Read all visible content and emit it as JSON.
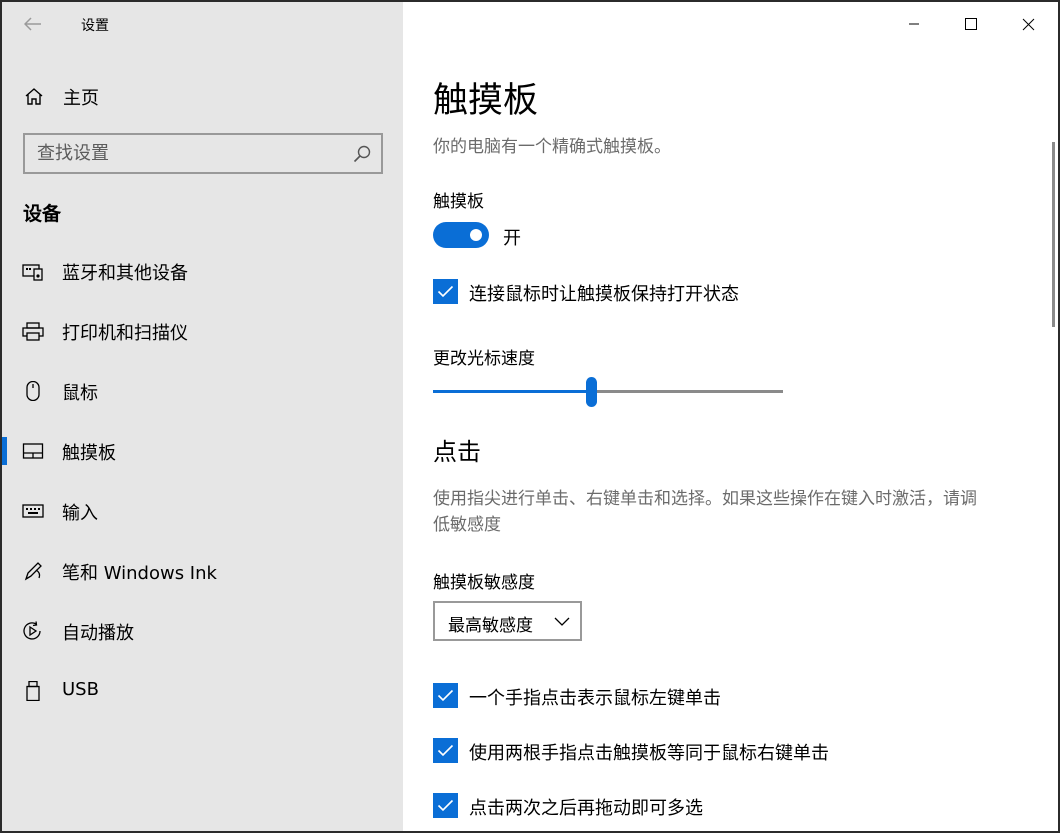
{
  "window": {
    "title": "设置"
  },
  "sidebar": {
    "home_label": "主页",
    "search_placeholder": "查找设置",
    "section_title": "设备",
    "items": [
      {
        "label": "蓝牙和其他设备",
        "icon": "bluetooth-devices-icon",
        "active": false
      },
      {
        "label": "打印机和扫描仪",
        "icon": "printer-icon",
        "active": false
      },
      {
        "label": "鼠标",
        "icon": "mouse-icon",
        "active": false
      },
      {
        "label": "触摸板",
        "icon": "touchpad-icon",
        "active": true
      },
      {
        "label": "输入",
        "icon": "keyboard-icon",
        "active": false
      },
      {
        "label": "笔和 Windows Ink",
        "icon": "pen-icon",
        "active": false
      },
      {
        "label": "自动播放",
        "icon": "autoplay-icon",
        "active": false
      },
      {
        "label": "USB",
        "icon": "usb-icon",
        "active": false
      }
    ]
  },
  "main": {
    "title": "触摸板",
    "description": "你的电脑有一个精确式触摸板。",
    "touchpad_label": "触摸板",
    "toggle_state": "开",
    "keep_on_with_mouse": "连接鼠标时让触摸板保持打开状态",
    "cursor_speed_label": "更改光标速度",
    "cursor_speed_value": 0.45,
    "tap_section_title": "点击",
    "tap_description": "使用指尖进行单击、右键单击和选择。如果这些操作在键入时激活，请调低敏感度",
    "sensitivity_label": "触摸板敏感度",
    "sensitivity_value": "最高敏感度",
    "options": [
      "一个手指点击表示鼠标左键单击",
      "使用两根手指点击触摸板等同于鼠标右键单击",
      "点击两次之后再拖动即可多选"
    ]
  },
  "colors": {
    "accent": "#0a6ed6",
    "sidebar_bg": "#e6e6e6"
  }
}
